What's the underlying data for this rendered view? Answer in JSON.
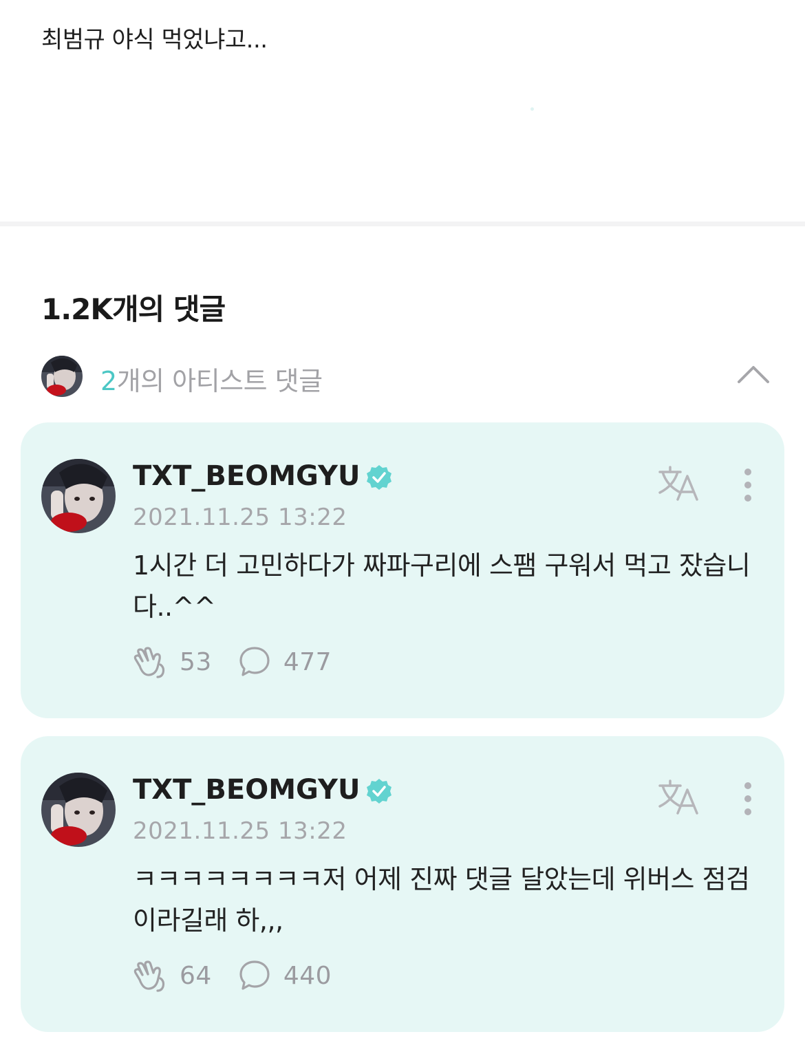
{
  "post": {
    "text": "최범규 야식 먹었냐고..."
  },
  "comments_section": {
    "header": "1.2K개의 댓글",
    "artist_row": {
      "count": "2",
      "label_suffix": "개의 아티스트 댓글"
    }
  },
  "comments": [
    {
      "author": "TXT_BEOMGYU",
      "date": "2021.11.25 13:22",
      "text": "1시간 더 고민하다가 짜파구리에 스팸 구워서 먹고 잤습니다..^^",
      "likes": "53",
      "replies": "477"
    },
    {
      "author": "TXT_BEOMGYU",
      "date": "2021.11.25 13:22",
      "text": "ㅋㅋㅋㅋㅋㅋㅋㅋ저 어제 진짜 댓글 달았는데 위버스 점검이라길래 하,,,",
      "likes": "64",
      "replies": "440"
    }
  ],
  "colors": {
    "accent": "#4cc7c5",
    "card_bg": "#e6f7f5",
    "verified": "#62d3d0",
    "muted": "#a2a2a6"
  }
}
